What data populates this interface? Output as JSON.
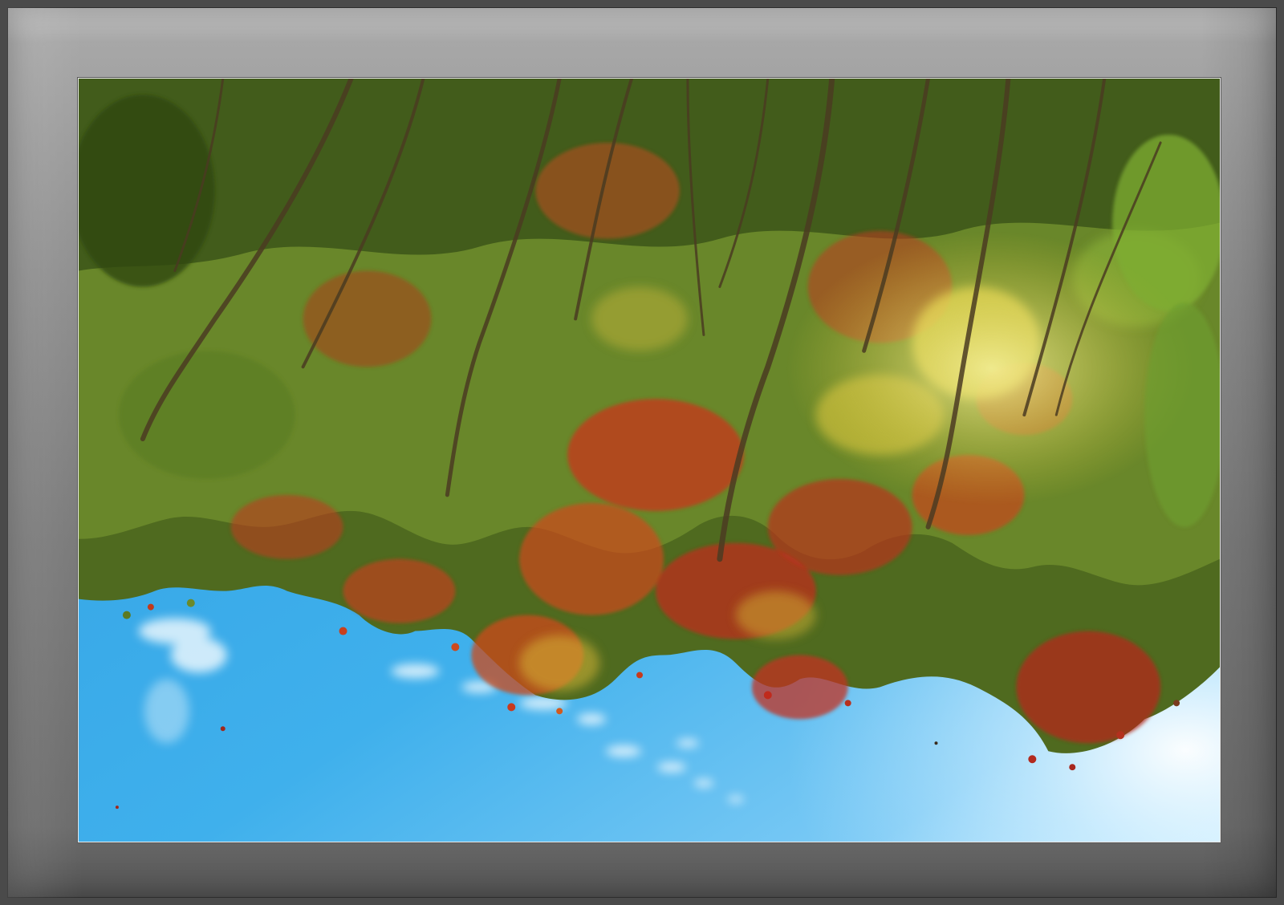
{
  "photo": {
    "subject": "autumn-maple-canopy",
    "colors": {
      "sky_top": "#2f9fe2",
      "sky_bottom": "#8fd4f7",
      "sky_glow": "#eaf8ff",
      "leaf_green_dark": "#3f5a1c",
      "leaf_green": "#6e8f2a",
      "leaf_yellow": "#c8b82e",
      "leaf_orange": "#d06a1e",
      "leaf_red": "#c62a1c",
      "branch": "#4a3a22",
      "frame_light": "#c9c9c9",
      "frame_dark": "#6b6b6b"
    }
  }
}
